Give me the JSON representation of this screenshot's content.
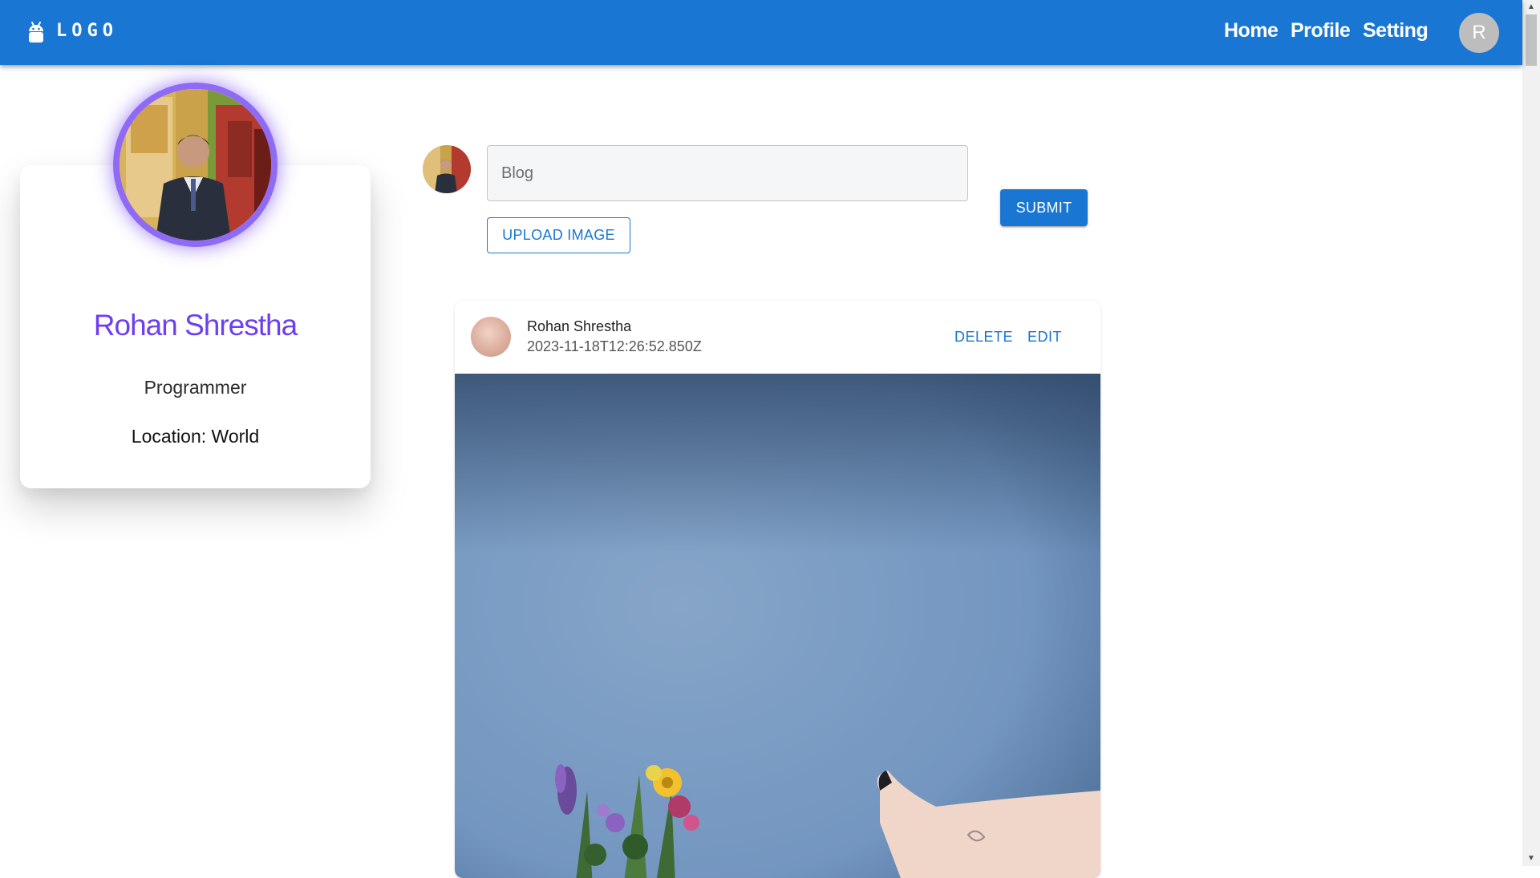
{
  "header": {
    "logo_text": "LOGO",
    "nav": {
      "home": "Home",
      "profile": "Profile",
      "setting": "Setting"
    },
    "avatar_initial": "R",
    "bar_color": "#1976d2"
  },
  "profile": {
    "name": "Rohan Shrestha",
    "title": "Programmer",
    "location": "Location: World",
    "accent_color": "#8f6bf5"
  },
  "composer": {
    "placeholder": "Blog",
    "upload_label": "UPLOAD IMAGE",
    "submit_label": "SUBMIT"
  },
  "post": {
    "author": "Rohan Shrestha",
    "timestamp": "2023-11-18T12:26:52.850Z",
    "delete_label": "DELETE",
    "edit_label": "EDIT"
  },
  "icons": {
    "logo": "android-icon",
    "scroll_up": "scroll-up-arrow-icon",
    "scroll_down": "scroll-down-arrow-icon"
  }
}
